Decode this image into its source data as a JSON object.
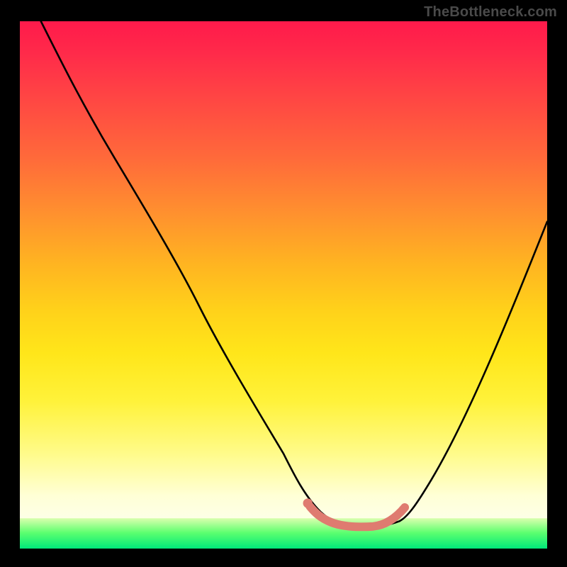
{
  "watermark": "TheBottleneck.com",
  "chart_data": {
    "type": "line",
    "title": "",
    "xlabel": "",
    "ylabel": "",
    "xlim": [
      0,
      100
    ],
    "ylim": [
      0,
      100
    ],
    "grid": false,
    "legend": false,
    "annotations": [],
    "series": [
      {
        "name": "main-curve",
        "color": "#000000",
        "x": [
          4,
          10,
          18,
          26,
          34,
          42,
          50,
          54,
          57,
          60,
          64,
          68,
          72,
          74,
          78,
          84,
          90,
          96,
          100
        ],
        "values": [
          100,
          88,
          74,
          60,
          46,
          32,
          18,
          11,
          7,
          5,
          4,
          4,
          5,
          7,
          13,
          24,
          38,
          52,
          62
        ]
      },
      {
        "name": "highlight-segment",
        "color": "#e0766a",
        "x": [
          55,
          57,
          59,
          61,
          63,
          65,
          67,
          69,
          71,
          73
        ],
        "values": [
          8,
          6,
          5,
          4,
          4,
          4,
          4,
          5,
          6,
          8
        ]
      }
    ],
    "background_gradient": {
      "orientation": "vertical",
      "stops": [
        {
          "pos": 0.0,
          "color": "#ff1a4b"
        },
        {
          "pos": 0.3,
          "color": "#ff7a34"
        },
        {
          "pos": 0.58,
          "color": "#ffe61a"
        },
        {
          "pos": 0.9,
          "color": "#ffffd6"
        },
        {
          "pos": 0.96,
          "color": "#88ff7a"
        },
        {
          "pos": 1.0,
          "color": "#00e87a"
        }
      ]
    }
  }
}
